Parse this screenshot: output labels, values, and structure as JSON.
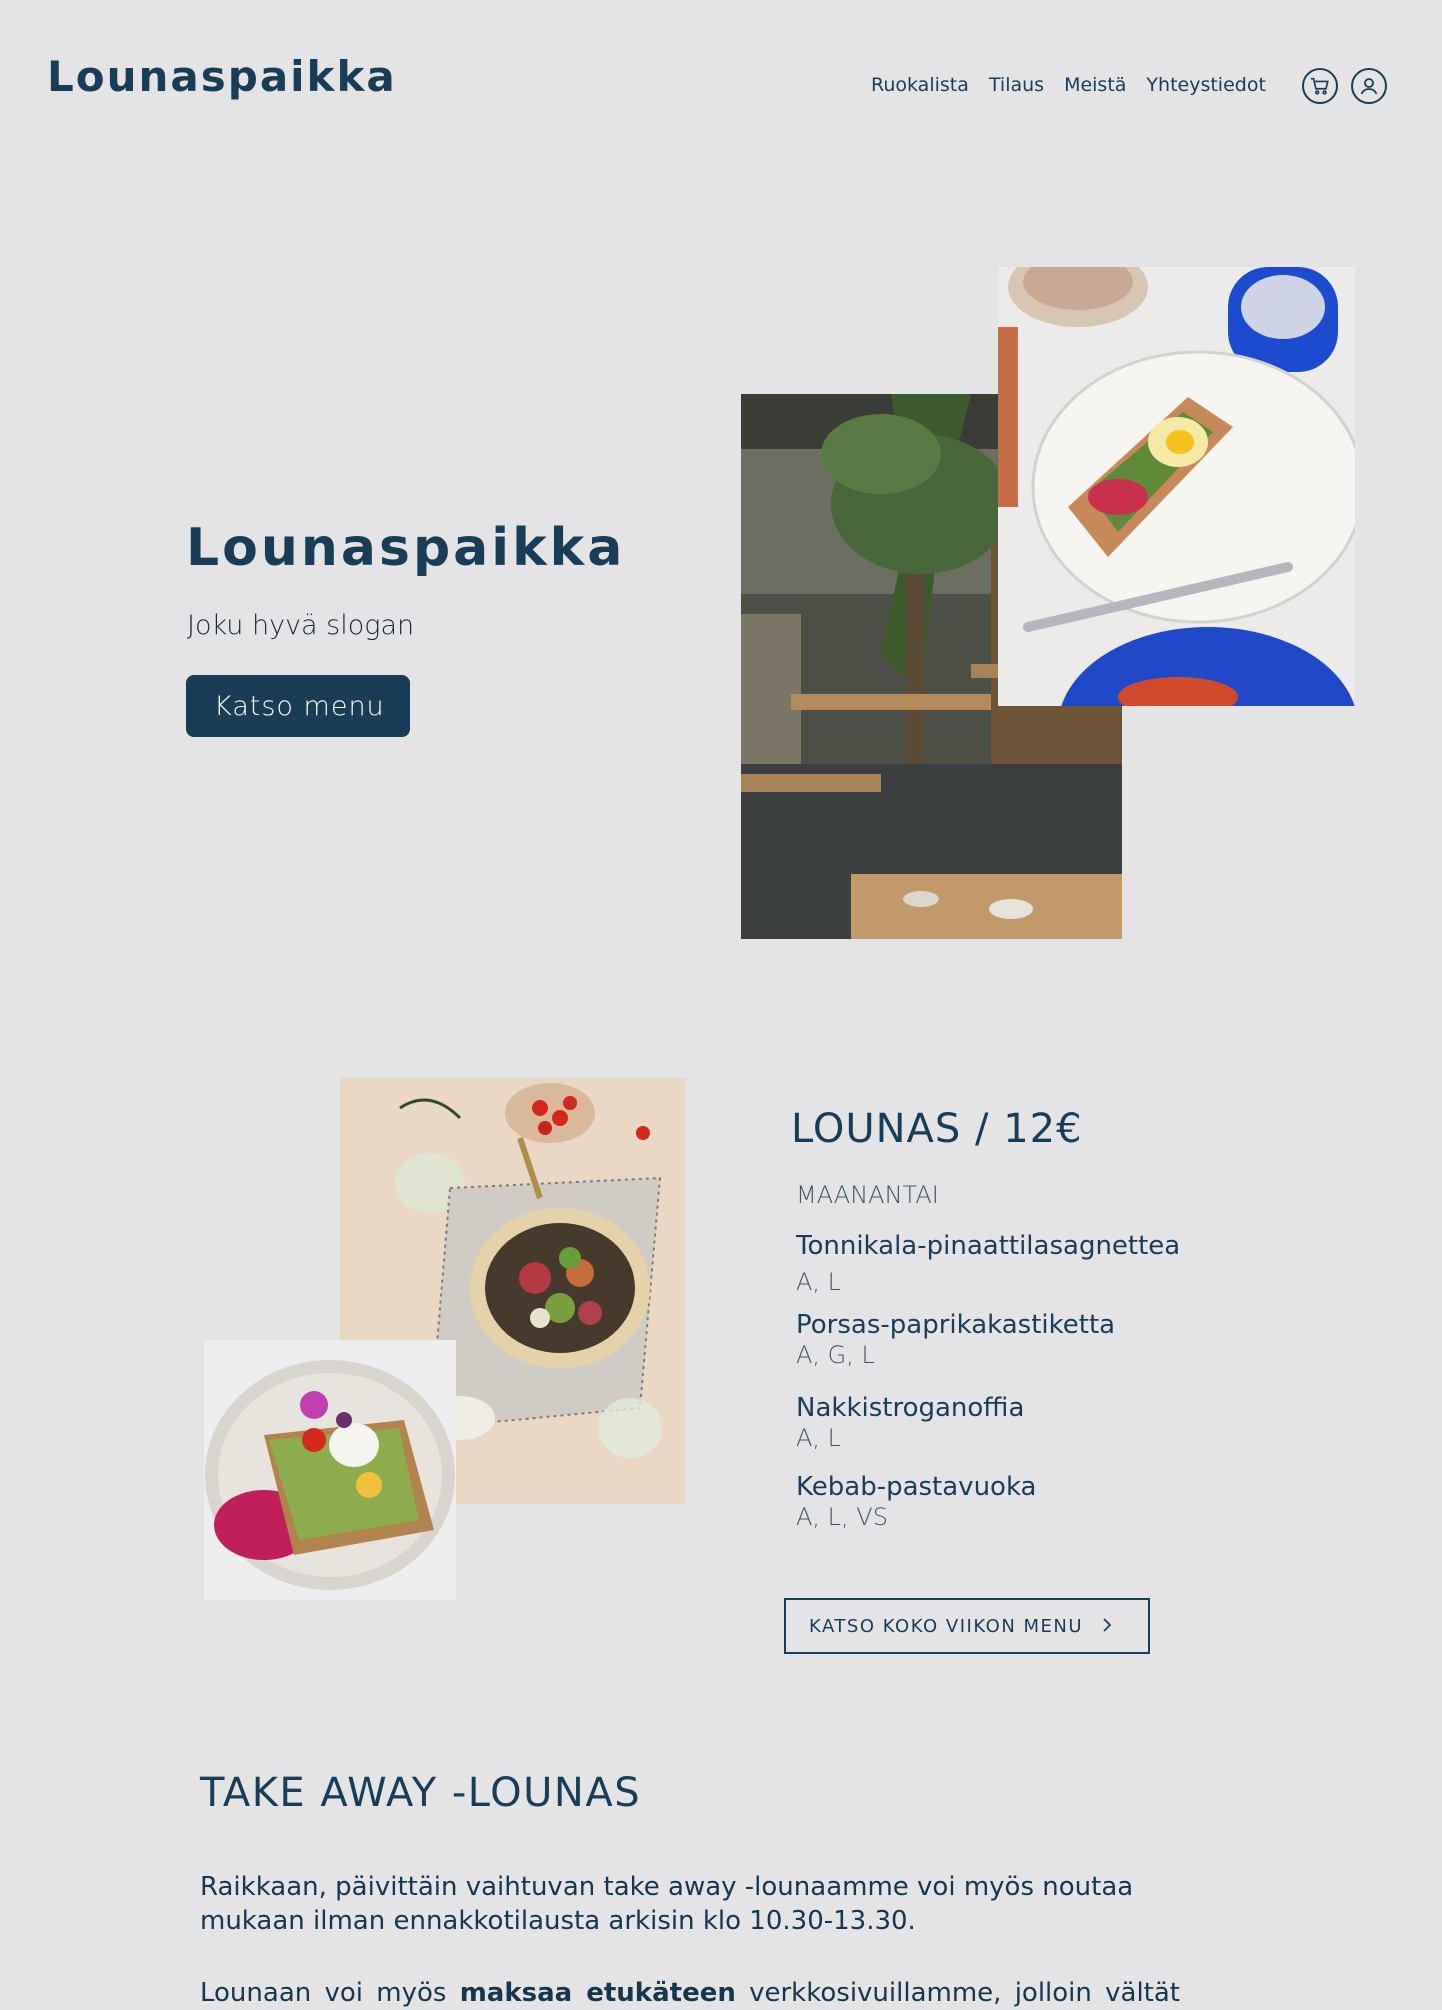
{
  "header": {
    "logo": "Lounaspaikka",
    "nav": [
      "Ruokalista",
      "Tilaus",
      "Meistä",
      "Yhteystiedot"
    ]
  },
  "hero": {
    "title": "Lounaspaikka",
    "slogan": "Joku hyvä slogan",
    "button": "Katso menu"
  },
  "lounas": {
    "title": "LOUNAS / 12€",
    "day": "MAANANTAI",
    "dishes": [
      {
        "name": "Tonnikala-pinaattilasagnettea",
        "diet": "A, L"
      },
      {
        "name": "Porsas-paprikakastiketta",
        "diet": "A, G, L"
      },
      {
        "name": "Nakkistroganoffia",
        "diet": "A, L"
      },
      {
        "name": "Kebab-pastavuoka",
        "diet": "A, L, VS"
      }
    ],
    "button": "KATSO KOKO VIIKON MENU"
  },
  "takeaway": {
    "title": "TAKE AWAY -LOUNAS",
    "text": "Raikkaan, päivittäin vaihtuvan take away -lounaamme voi myös noutaa mukaan ilman ennakkotilausta arkisin klo 10.30-13.30.",
    "text2_before": "Lounaan voi myös ",
    "text2_bold": "maksaa etukäteen",
    "text2_after": " verkkosivuillamme, jolloin vältät"
  },
  "colors": {
    "background": "#e4e4e6",
    "primary": "#193d57"
  },
  "icons": [
    "cart-icon",
    "user-icon",
    "chevron-right-icon"
  ]
}
